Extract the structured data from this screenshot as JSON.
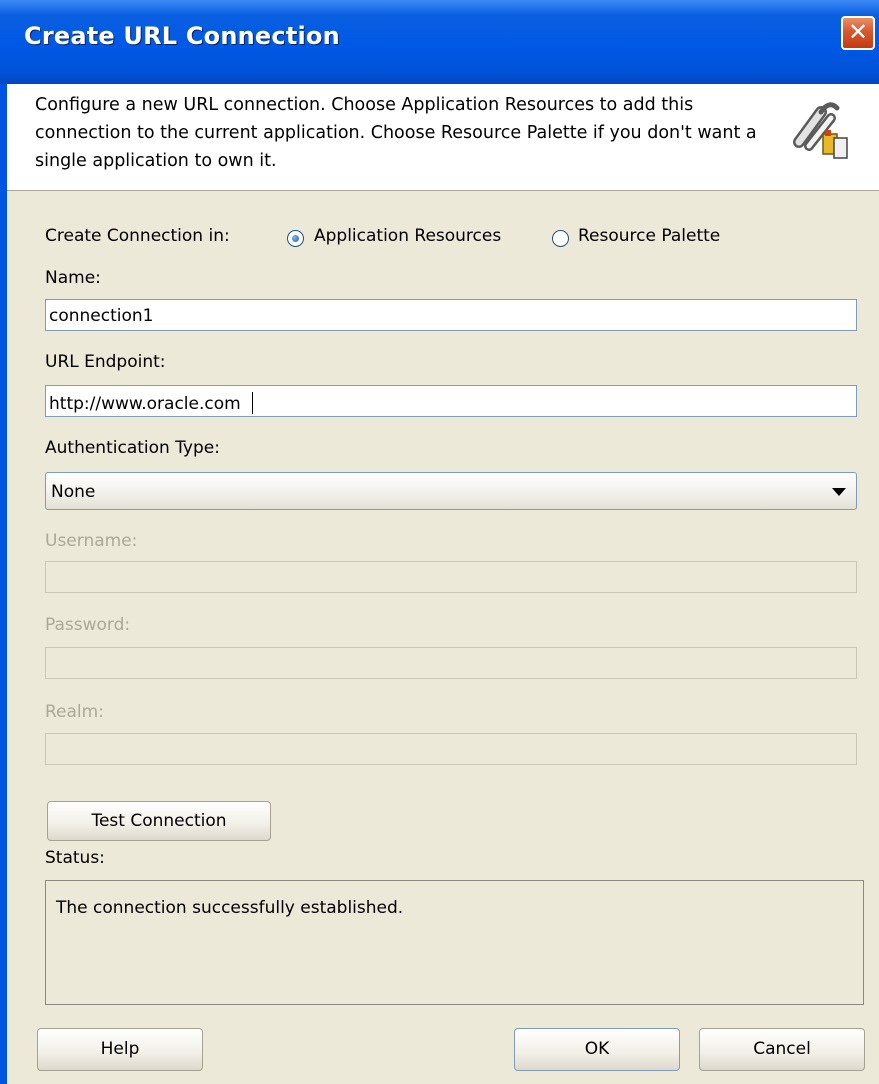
{
  "dialog": {
    "title": "Create URL Connection",
    "close_glyph": "✕",
    "description": "Configure a new URL connection.  Choose Application Resources to add this connection to the current application. Choose Resource Palette if you don't want a single application to own it.",
    "header_icon": "chain-link-icon"
  },
  "create_in": {
    "label": "Create Connection in:",
    "options": [
      {
        "label": "Application Resources",
        "selected": true
      },
      {
        "label": "Resource Palette",
        "selected": false
      }
    ]
  },
  "fields": {
    "name": {
      "label": "Name:",
      "value": "connection1"
    },
    "url": {
      "label": "URL Endpoint:",
      "value": "http://www.oracle.com "
    },
    "auth_type": {
      "label": "Authentication Type:",
      "value": "None"
    },
    "username": {
      "label": "Username:",
      "value": "",
      "enabled": false
    },
    "password": {
      "label": "Password:",
      "value": "",
      "enabled": false
    },
    "realm": {
      "label": "Realm:",
      "value": "",
      "enabled": false
    }
  },
  "test": {
    "button_label": "Test Connection",
    "status_label": "Status:",
    "status_text": "The connection successfully established."
  },
  "footer": {
    "help": "Help",
    "ok": "OK",
    "cancel": "Cancel"
  },
  "colors": {
    "title_bar": "#0054e3",
    "close_button": "#d8582c",
    "dialog_bg": "#ece9d8",
    "field_border": "#7f9db9",
    "disabled_text": "#aca899"
  }
}
